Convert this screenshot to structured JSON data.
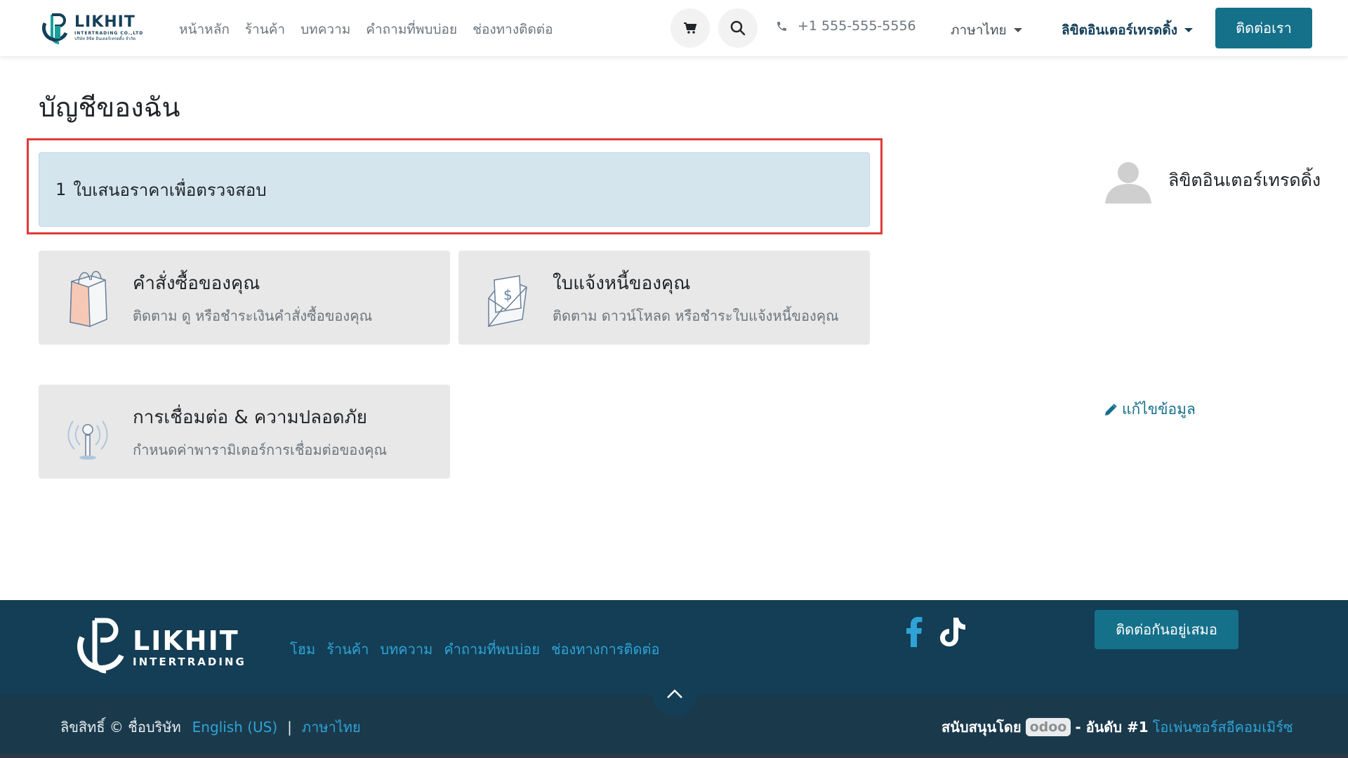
{
  "header": {
    "logo": {
      "brand": "LIKHIT",
      "sub1": "INTERTRADING CO.,LTD",
      "sub2": "บริษัท ลิขิต อินเตอร์เทรดดิ้ง จำกัด"
    },
    "nav": [
      "หน้าหลัก",
      "ร้านค้า",
      "บทความ",
      "คำถามที่พบบ่อย",
      "ช่องทางติดต่อ"
    ],
    "phone": "+1 555-555-5556",
    "language": "ภาษาไทย",
    "user": "ลิขิตอินเตอร์เทรดดิ้ง",
    "contact_button": "ติดต่อเรา"
  },
  "main": {
    "title": "บัญชีของฉัน",
    "alert": {
      "count": "1",
      "text": "ใบเสนอราคาเพื่อตรวจสอบ"
    },
    "cards": [
      {
        "title": "คำสั่งซื้อของคุณ",
        "subtitle": "ติดตาม ดู หรือชำระเงินคำสั่งซื้อของคุณ",
        "icon": "shopping-bag-icon"
      },
      {
        "title": "ใบแจ้งหนี้ของคุณ",
        "subtitle": "ติดตาม ดาวน์โหลด หรือชำระใบแจ้งหนี้ของคุณ",
        "icon": "invoice-envelope-icon"
      },
      {
        "title": "การเชื่อมต่อ & ความปลอดภัย",
        "subtitle": "กำหนดค่าพารามิเตอร์การเชื่อมต่อของคุณ",
        "icon": "antenna-signal-icon"
      }
    ],
    "sidebar": {
      "name": "ลิขิตอินเตอร์เทรดดิ้ง",
      "edit_label": "แก้ไขข้อมูล"
    }
  },
  "footer": {
    "logo": {
      "brand": "LIKHIT",
      "sub": "INTERTRADING"
    },
    "nav": [
      "โฮม",
      "ร้านค้า",
      "บทความ",
      "คำถามที่พบบ่อย",
      "ช่องทางการติดต่อ"
    ],
    "button": "ติดต่อกันอยู่เสมอ",
    "copyright": "ลิขสิทธิ์ © ชื่อบริษัท",
    "lang_en": "English (US)",
    "lang_sep": "|",
    "lang_th": "ภาษาไทย",
    "powered_prefix": "สนับสนุนโดย",
    "odoo": "odoo",
    "powered_mid": "- อันดับ #1",
    "powered_link": "โอเพ่นซอร์สอีคอมเมิร์ซ"
  },
  "colors": {
    "primary": "#15708a",
    "dark_navy": "#133e55",
    "link_blue": "#2fa3d6",
    "alert_bg": "#d4e5ee",
    "highlight_red": "#e03a3a"
  }
}
